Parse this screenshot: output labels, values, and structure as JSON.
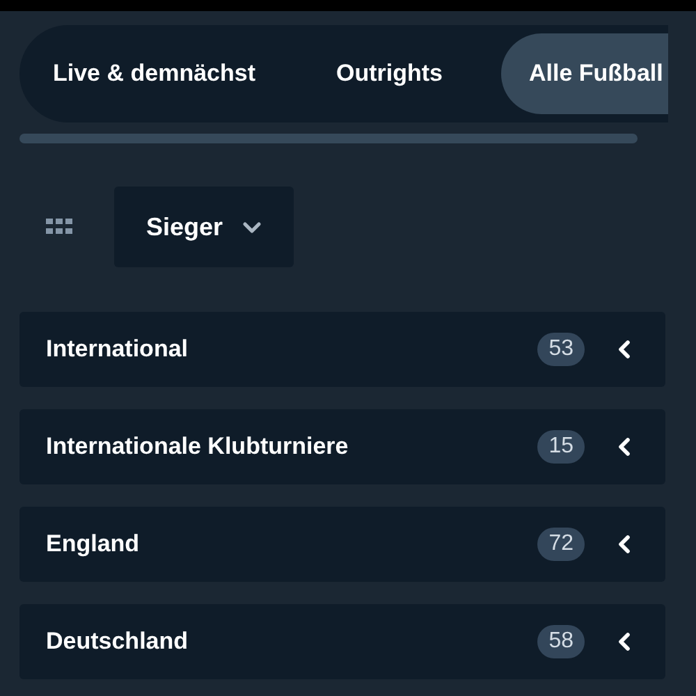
{
  "tabs": [
    {
      "label": "Live & demnächst",
      "selected": false
    },
    {
      "label": "Outrights",
      "selected": false
    },
    {
      "label": "Alle Fußball",
      "selected": true
    }
  ],
  "market_dropdown": {
    "label": "Sieger"
  },
  "categories": [
    {
      "name": "International",
      "count": "53"
    },
    {
      "name": "Internationale Klubturniere",
      "count": "15"
    },
    {
      "name": "England",
      "count": "72"
    },
    {
      "name": "Deutschland",
      "count": "58"
    }
  ]
}
